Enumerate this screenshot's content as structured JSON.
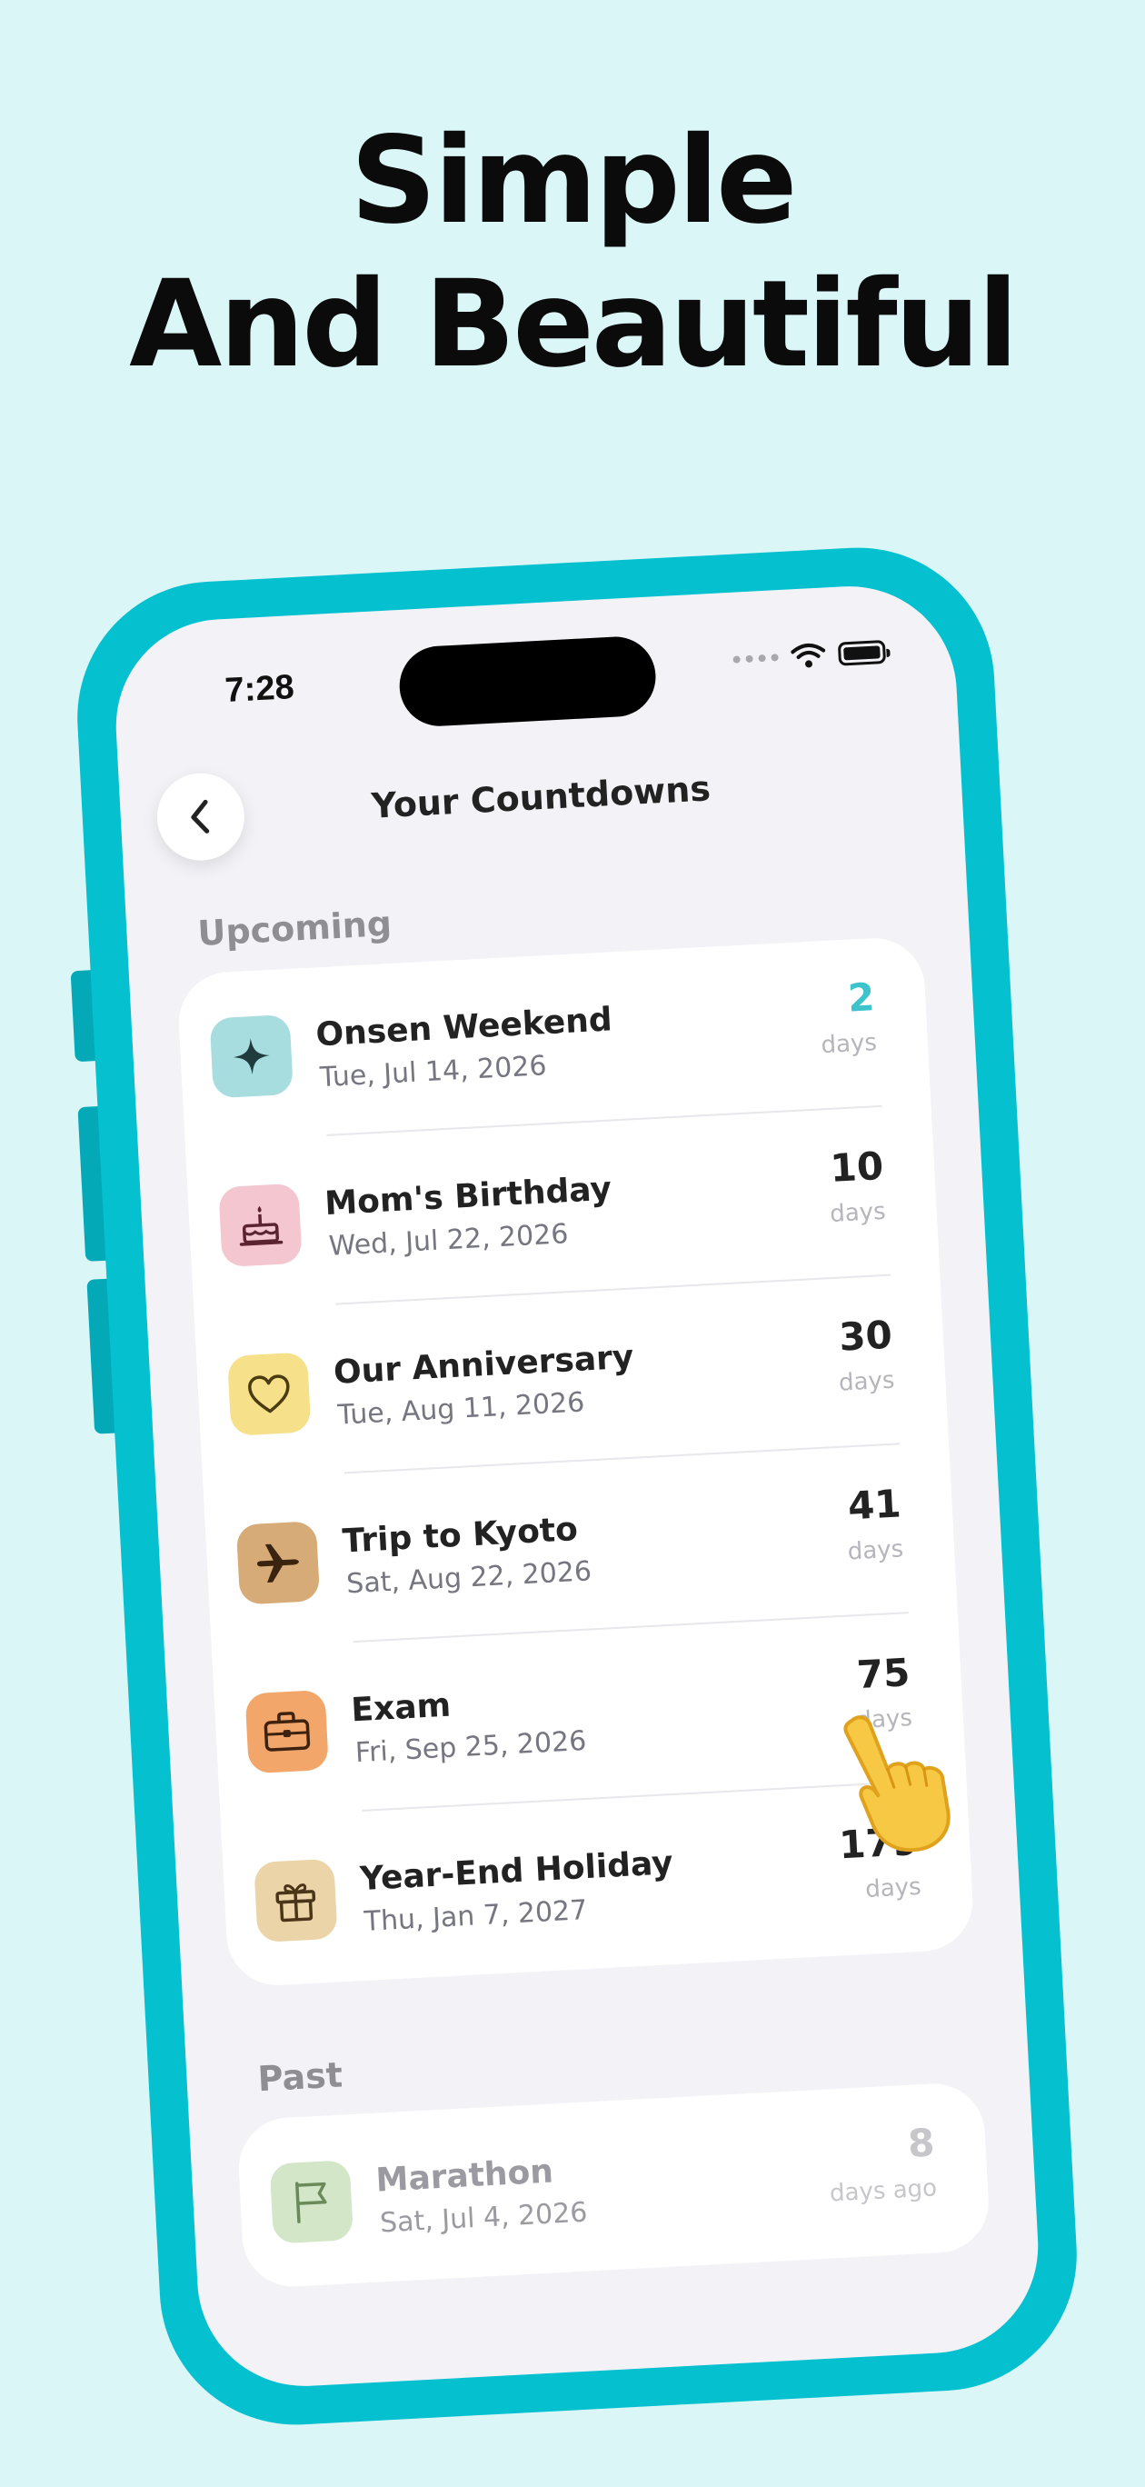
{
  "headline": {
    "line1": "Simple",
    "line2": "And Beautiful"
  },
  "status_bar": {
    "time": "7:28"
  },
  "nav": {
    "title": "Your Countdowns"
  },
  "sections": {
    "upcoming": {
      "title": "Upcoming",
      "items": [
        {
          "title": "Onsen Weekend",
          "date": "Tue, Jul 14, 2026",
          "value": "2",
          "unit": "days",
          "icon": "sparkle-icon",
          "icon_bg": "#a8dde0",
          "value_color": "#3cc3cc"
        },
        {
          "title": "Mom's Birthday",
          "date": "Wed, Jul 22, 2026",
          "value": "10",
          "unit": "days",
          "icon": "cake-icon",
          "icon_bg": "#f4c6d0",
          "value_color": "#222222"
        },
        {
          "title": "Our Anniversary",
          "date": "Tue, Aug 11, 2026",
          "value": "30",
          "unit": "days",
          "icon": "heart-icon",
          "icon_bg": "#f6e08a",
          "value_color": "#222222"
        },
        {
          "title": "Trip to Kyoto",
          "date": "Sat, Aug 22, 2026",
          "value": "41",
          "unit": "days",
          "icon": "airplane-icon",
          "icon_bg": "#d7ab78",
          "value_color": "#222222"
        },
        {
          "title": "Exam",
          "date": "Fri, Sep 25, 2026",
          "value": "75",
          "unit": "days",
          "icon": "briefcase-icon",
          "icon_bg": "#f3a66a",
          "value_color": "#222222"
        },
        {
          "title": "Year-End Holiday",
          "date": "Thu, Jan 7, 2027",
          "value": "179",
          "unit": "days",
          "icon": "gift-icon",
          "icon_bg": "#ead4a8",
          "value_color": "#222222"
        }
      ]
    },
    "past": {
      "title": "Past",
      "items": [
        {
          "title": "Marathon",
          "date": "Sat, Jul 4, 2026",
          "value": "8",
          "unit": "days ago",
          "icon": "flag-icon",
          "icon_bg": "#d3e6c8"
        }
      ]
    }
  },
  "colors": {
    "background": "#dbf6f7",
    "phone_frame": "#05c0cf",
    "accent": "#3cc3cc"
  }
}
